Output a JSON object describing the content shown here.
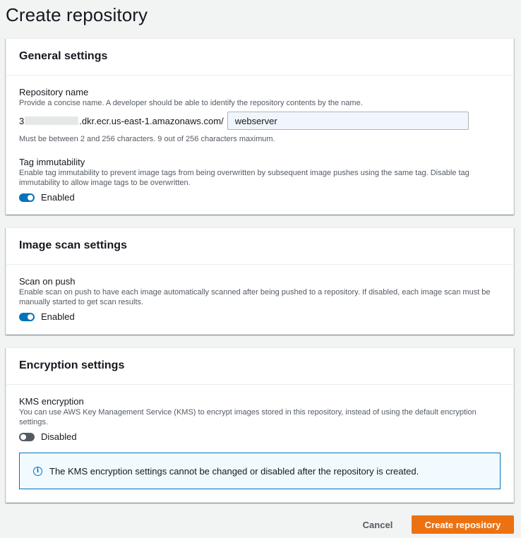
{
  "page": {
    "title": "Create repository"
  },
  "general": {
    "title": "General settings",
    "repo_name": {
      "label": "Repository name",
      "description": "Provide a concise name. A developer should be able to identify the repository contents by the name.",
      "prefix_start": "3",
      "prefix_end": ".dkr.ecr.us-east-1.amazonaws.com/",
      "value": "webserver",
      "hint": "Must be between 2 and 256 characters. 9 out of 256 characters maximum."
    },
    "tag_immutability": {
      "label": "Tag immutability",
      "description": "Enable tag immutability to prevent image tags from being overwritten by subsequent image pushes using the same tag. Disable tag immutability to allow image tags to be overwritten.",
      "state_label": "Enabled",
      "enabled": true
    }
  },
  "scan": {
    "title": "Image scan settings",
    "scan_on_push": {
      "label": "Scan on push",
      "description": "Enable scan on push to have each image automatically scanned after being pushed to a repository. If disabled, each image scan must be manually started to get scan results.",
      "state_label": "Enabled",
      "enabled": true
    }
  },
  "encryption": {
    "title": "Encryption settings",
    "kms": {
      "label": "KMS encryption",
      "description": "You can use AWS Key Management Service (KMS) to encrypt images stored in this repository, instead of using the default encryption settings.",
      "state_label": "Disabled",
      "enabled": false
    },
    "alert": {
      "icon": "info-icon",
      "text": "The KMS encryption settings cannot be changed or disabled after the repository is created."
    }
  },
  "actions": {
    "cancel_label": "Cancel",
    "create_label": "Create repository"
  },
  "colors": {
    "accent": "#0073bb",
    "primary_button": "#ec7211",
    "background": "#f2f3f3"
  }
}
